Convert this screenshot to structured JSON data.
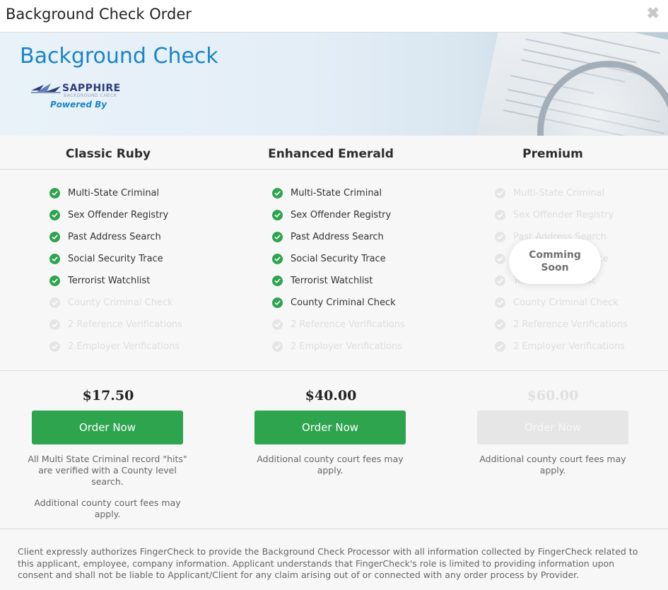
{
  "modal": {
    "title": "Background Check Order",
    "close_icon": "close-icon",
    "close_glyph": "✖"
  },
  "banner": {
    "title": "Background Check",
    "logo_name": "SAPPHIRE",
    "logo_subtext": "BACKGROUND CHECK",
    "powered_by": "Powered By"
  },
  "plans": [
    {
      "name": "Classic Ruby",
      "features": [
        {
          "label": "Multi-State Criminal",
          "included": true
        },
        {
          "label": "Sex Offender Registry",
          "included": true
        },
        {
          "label": "Past Address Search",
          "included": true
        },
        {
          "label": "Social Security Trace",
          "included": true
        },
        {
          "label": "Terrorist Watchlist",
          "included": true
        },
        {
          "label": "County Criminal Check",
          "included": false
        },
        {
          "label": "2 Reference Verifications",
          "included": false
        },
        {
          "label": "2 Employer Verifications",
          "included": false
        }
      ],
      "price": "$17.50",
      "button_label": "Order Now",
      "notes": [
        "All Multi State Criminal record \"hits\" are verified with a County level search.",
        "Additional county court fees may apply."
      ]
    },
    {
      "name": "Enhanced Emerald",
      "features": [
        {
          "label": "Multi-State Criminal",
          "included": true
        },
        {
          "label": "Sex Offender Registry",
          "included": true
        },
        {
          "label": "Past Address Search",
          "included": true
        },
        {
          "label": "Social Security Trace",
          "included": true
        },
        {
          "label": "Terrorist Watchlist",
          "included": true
        },
        {
          "label": "County Criminal Check",
          "included": true
        },
        {
          "label": "2 Reference Verifications",
          "included": false
        },
        {
          "label": "2 Employer Verifications",
          "included": false
        }
      ],
      "price": "$40.00",
      "button_label": "Order Now",
      "notes": [
        "Additional county court fees may apply."
      ]
    },
    {
      "name": "Premium",
      "features": [
        {
          "label": "Multi-State Criminal",
          "included": false
        },
        {
          "label": "Sex Offender Registry",
          "included": false
        },
        {
          "label": "Past Address Search",
          "included": false
        },
        {
          "label": "Social Security Trace",
          "included": false
        },
        {
          "label": "Terrorist Watchlist",
          "included": false
        },
        {
          "label": "County Criminal Check",
          "included": false
        },
        {
          "label": "2 Reference Verifications",
          "included": false
        },
        {
          "label": "2 Employer Verifications",
          "included": false
        }
      ],
      "price": "$60.00",
      "button_label": "Order Now",
      "disabled": true,
      "coming_soon": [
        "Comming",
        "Soon"
      ],
      "notes": [
        "Additional county court fees may apply."
      ]
    }
  ],
  "disclaimer": "Client expressly authorizes FingerCheck to provide the Background Check Processor with all information collected by FingerCheck related to this applicant, employee, company information. Applicant understands that FingerCheck's role is limited to providing information upon consent and shall not be liable to Applicant/Client for any claim arising out of or connected with any order process by Provider.",
  "colors": {
    "accent_green": "#2ea44f",
    "title_blue": "#1a84c8",
    "disabled_gray": "#e6e6e6"
  },
  "icons": {
    "included": "check-circle-icon",
    "excluded": "check-circle-disabled-icon"
  }
}
